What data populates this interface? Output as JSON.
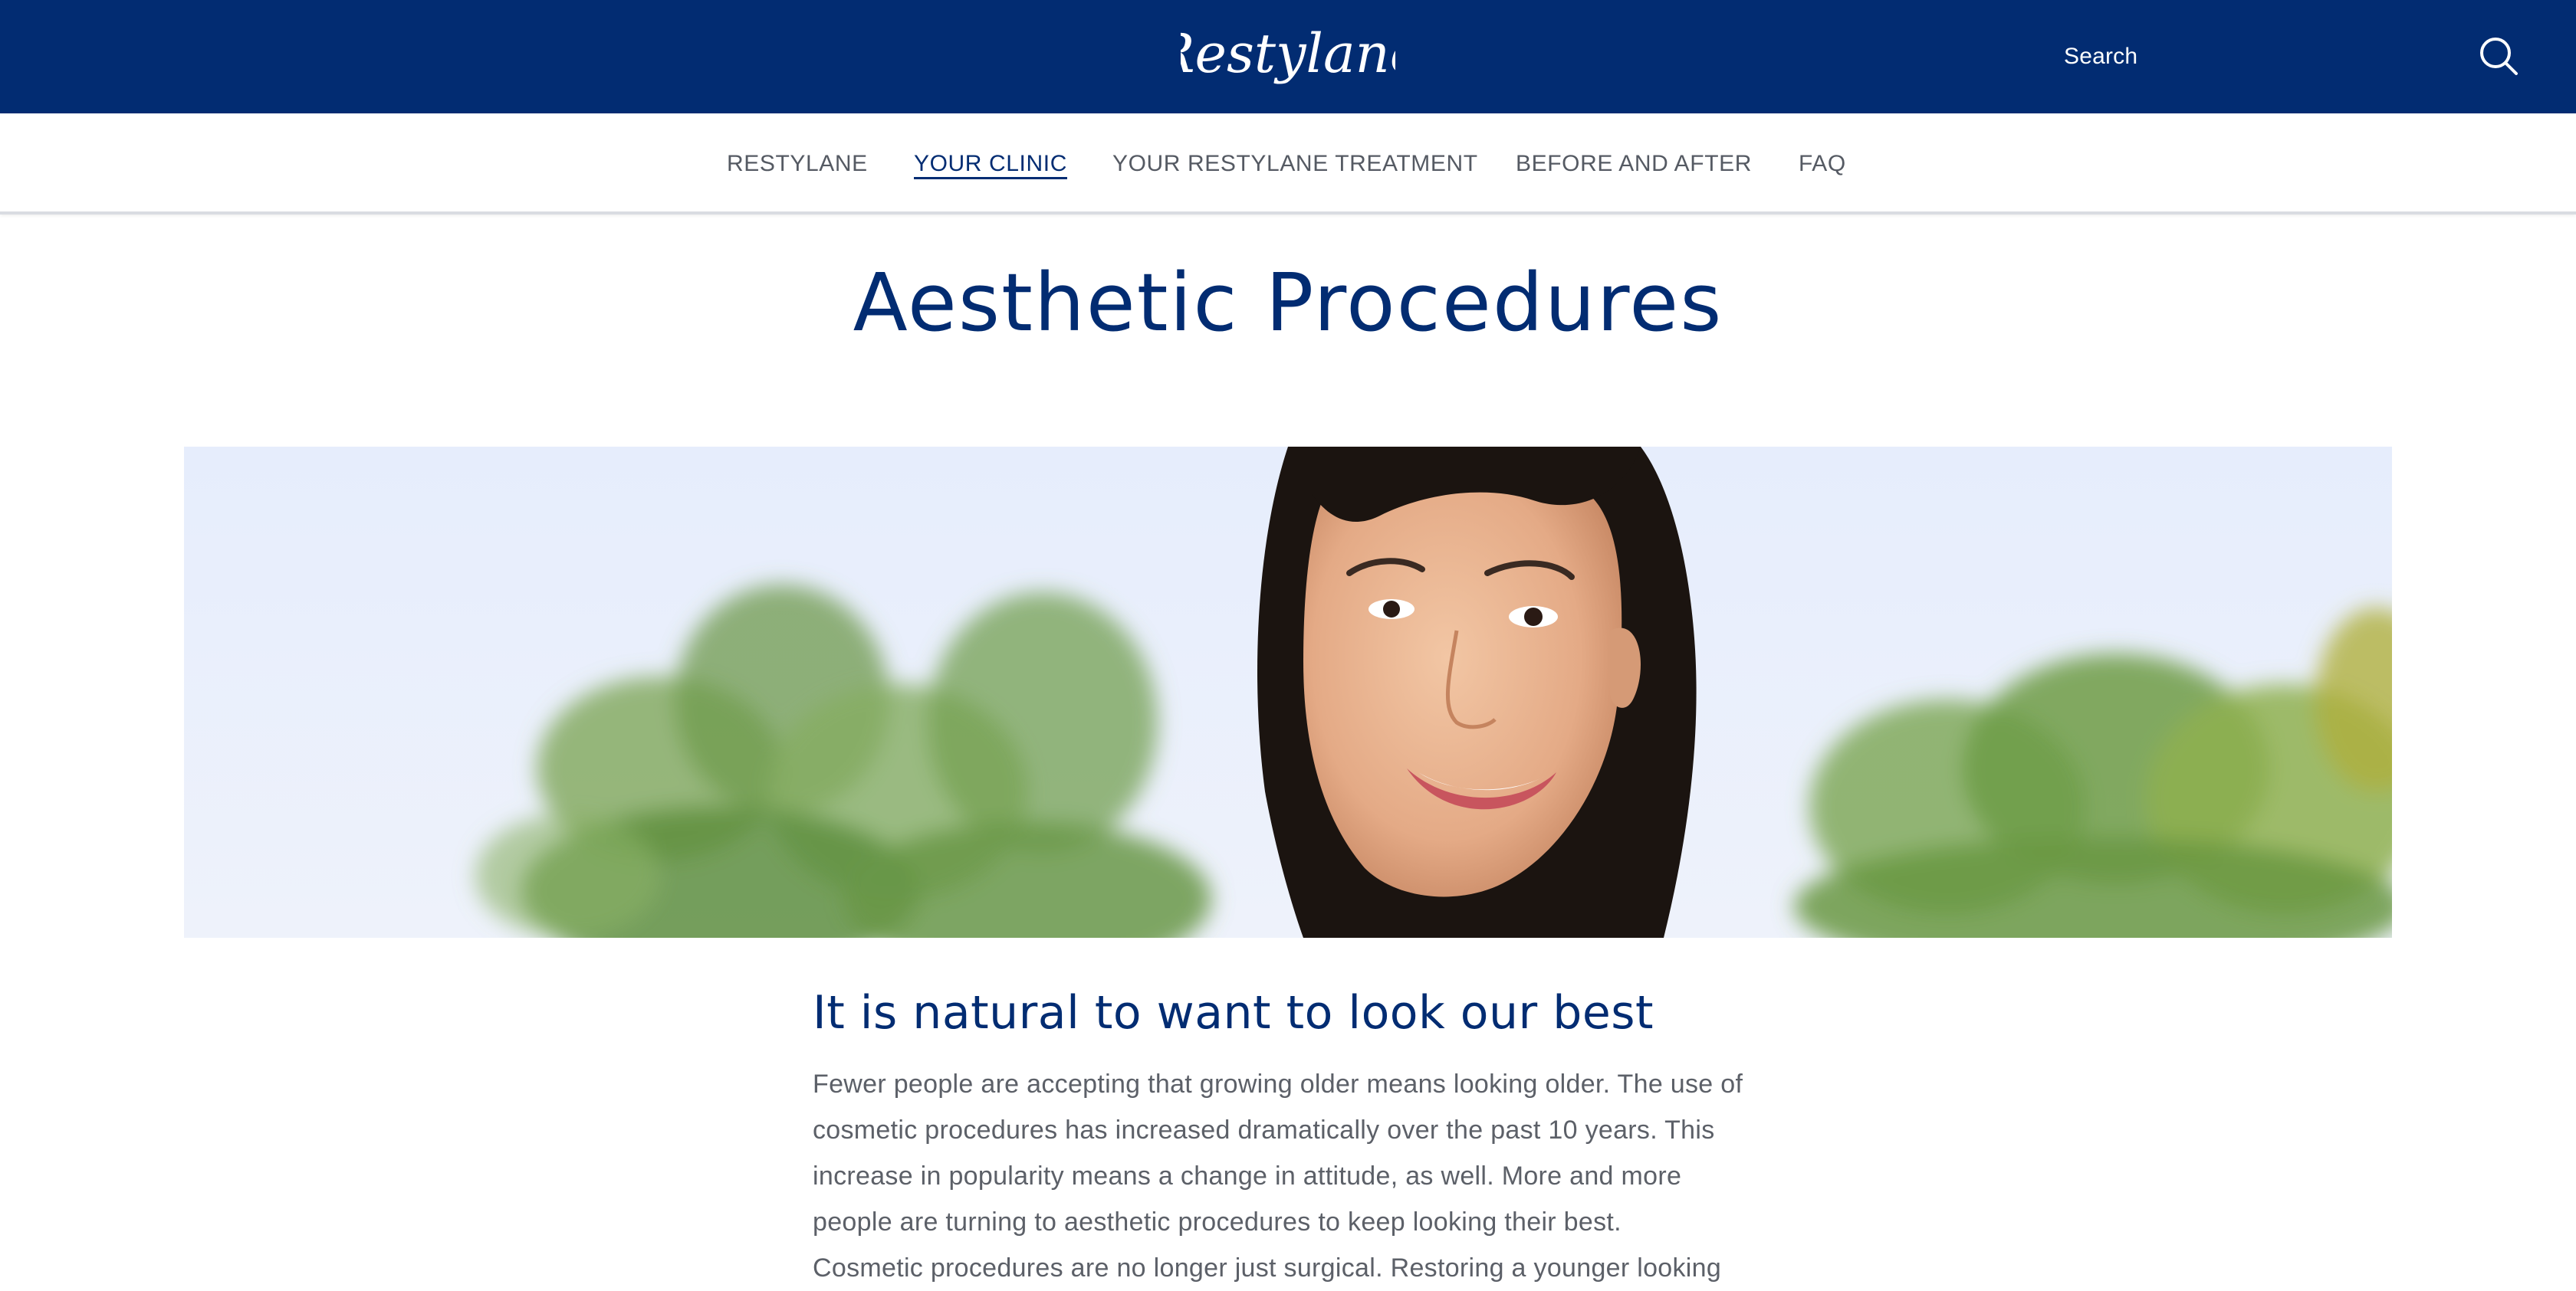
{
  "header": {
    "logo_text": "Restylane",
    "search": {
      "label": "Search",
      "icon": "search-icon"
    },
    "background_color": "#022c72"
  },
  "nav": {
    "items": [
      {
        "label": "RESTYLANE",
        "active": false
      },
      {
        "label": "YOUR CLINIC",
        "active": true
      },
      {
        "label": "YOUR RESTYLANE TREATMENT",
        "active": false
      },
      {
        "label": "BEFORE AND AFTER",
        "active": false
      },
      {
        "label": "FAQ",
        "active": false
      }
    ]
  },
  "page": {
    "title": "Aesthetic Procedures"
  },
  "content": {
    "heading": "It is natural to want to look our best",
    "paragraphs": [
      "Fewer people are accepting that growing older means looking older. The use of cosmetic procedures has increased dramatically over the past 10 years. This increase in popularity means a change in attitude, as well. More and more people are turning to aesthetic procedures to keep looking their best.",
      "Cosmetic procedures are no longer just surgical. Restoring a younger looking"
    ]
  },
  "colors": {
    "brand_navy": "#022c72",
    "body_text": "#5c6068",
    "nav_text": "#555a63"
  }
}
